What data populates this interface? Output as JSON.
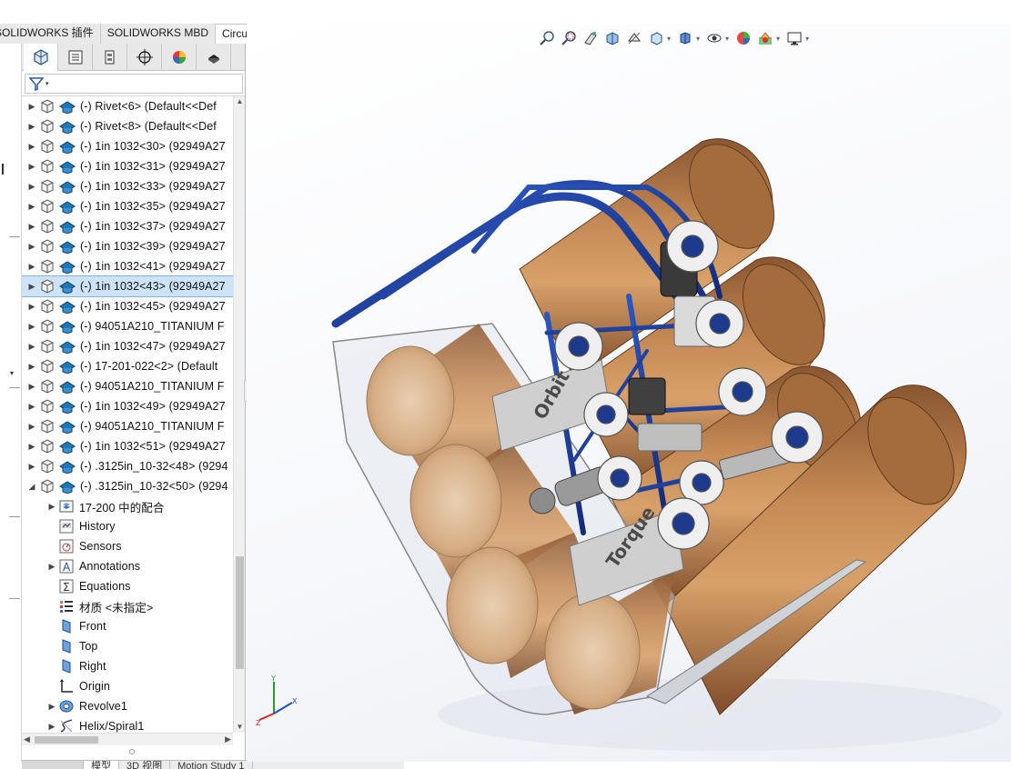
{
  "tabs": [
    {
      "label": "SOLIDWORKS 插件",
      "active": false
    },
    {
      "label": "SOLIDWORKS MBD",
      "active": false
    },
    {
      "label": "CircuitWorks",
      "active": true
    }
  ],
  "panel_tabs": [
    "feature-manager",
    "property-manager",
    "configuration-manager",
    "dimxpert-manager",
    "display-manager",
    "cam-manager"
  ],
  "filter": {
    "icon": "filter-icon"
  },
  "tree": {
    "components": [
      {
        "label": "(-) Rivet<6> (Default<<Def",
        "selected": false
      },
      {
        "label": "(-) Rivet<8> (Default<<Def",
        "selected": false
      },
      {
        "label": "(-) 1in 1032<30> (92949A27",
        "selected": false
      },
      {
        "label": "(-) 1in 1032<31> (92949A27",
        "selected": false
      },
      {
        "label": "(-) 1in 1032<33> (92949A27",
        "selected": false
      },
      {
        "label": "(-) 1in 1032<35> (92949A27",
        "selected": false
      },
      {
        "label": "(-) 1in 1032<37> (92949A27",
        "selected": false
      },
      {
        "label": "(-) 1in 1032<39> (92949A27",
        "selected": false
      },
      {
        "label": "(-) 1in 1032<41> (92949A27",
        "selected": false
      },
      {
        "label": "(-) 1in 1032<43> (92949A27",
        "selected": true
      },
      {
        "label": "(-) 1in 1032<45> (92949A27",
        "selected": false
      },
      {
        "label": "(-) 94051A210_TITANIUM F",
        "selected": false
      },
      {
        "label": "(-) 1in 1032<47> (92949A27",
        "selected": false
      },
      {
        "label": "(-) 17-201-022<2> (Default",
        "selected": false
      },
      {
        "label": "(-) 94051A210_TITANIUM F",
        "selected": false
      },
      {
        "label": "(-) 1in 1032<49> (92949A27",
        "selected": false
      },
      {
        "label": "(-) 94051A210_TITANIUM F",
        "selected": false
      },
      {
        "label": "(-) 1in 1032<51> (92949A27",
        "selected": false
      },
      {
        "label": "(-) .3125in_10-32<48> (9294",
        "selected": false
      },
      {
        "label": "(-) .3125in_10-32<50> (9294",
        "selected": false
      }
    ],
    "features": [
      {
        "label": "17-200 中的配合",
        "icon": "folder-mates-icon",
        "expandable": true
      },
      {
        "label": "History",
        "icon": "history-icon",
        "expandable": false
      },
      {
        "label": "Sensors",
        "icon": "sensors-icon",
        "expandable": false
      },
      {
        "label": "Annotations",
        "icon": "annotations-icon",
        "expandable": true
      },
      {
        "label": "Equations",
        "icon": "equations-icon",
        "expandable": false
      },
      {
        "label": "材质 <未指定>",
        "icon": "material-icon",
        "expandable": false
      },
      {
        "label": "Front",
        "icon": "plane-icon",
        "expandable": false
      },
      {
        "label": "Top",
        "icon": "plane-icon",
        "expandable": false
      },
      {
        "label": "Right",
        "icon": "plane-icon",
        "expandable": false
      },
      {
        "label": "Origin",
        "icon": "origin-icon",
        "expandable": false
      },
      {
        "label": "Revolve1",
        "icon": "revolve-icon",
        "expandable": true
      },
      {
        "label": "Helix/Spiral1",
        "icon": "helix-icon",
        "expandable": true
      }
    ]
  },
  "bottom_tabs": [
    "模型",
    "3D 视图",
    "Motion Study 1"
  ],
  "heads_up_toolbar": [
    "zoom-to-fit-icon",
    "zoom-to-area-icon",
    "previous-view-icon",
    "section-view-icon",
    "dynamic-annotation-icon",
    "view-orientation-icon",
    "display-style-icon",
    "hide-show-items-icon",
    "edit-appearance-icon",
    "apply-scene-icon",
    "view-settings-icon"
  ],
  "model": {
    "panel_labels": [
      "Orbit",
      "Torque"
    ],
    "colors": {
      "wood": "#b27a4a",
      "frame": "#1f3f96",
      "wheel": "#e8e8e8",
      "plate": "#c9c9c9"
    }
  },
  "triad": {
    "axes": [
      "Y",
      "X",
      "Z"
    ]
  }
}
